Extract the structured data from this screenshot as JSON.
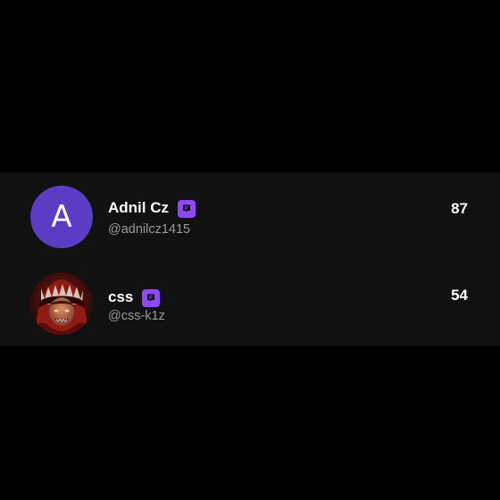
{
  "colors": {
    "background": "#000000",
    "list_background": "#111111",
    "accent_purple": "#9147ff",
    "avatar_purple": "#5b3cc4",
    "handle_gray": "#9a9a9a"
  },
  "users": [
    {
      "name": "Adnil Cz",
      "handle": "@adnilcz1415",
      "score": "87",
      "avatar_letter": "A",
      "badge_icon": "chat-badge-icon"
    },
    {
      "name": "css",
      "handle": "@css-k1z",
      "score": "54",
      "avatar_image": "illustrated-red-hood-portrait",
      "badge_icon": "chat-badge-icon"
    }
  ]
}
